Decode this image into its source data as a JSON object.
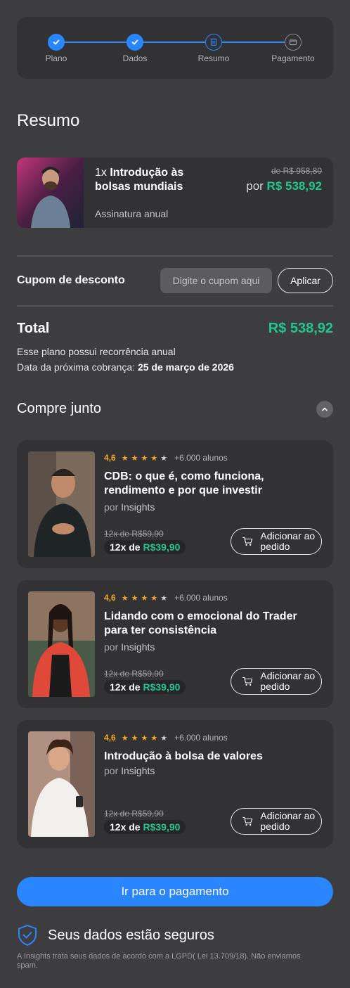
{
  "steps": [
    {
      "label": "Plano",
      "state": "done"
    },
    {
      "label": "Dados",
      "state": "done"
    },
    {
      "label": "Resumo",
      "state": "current"
    },
    {
      "label": "Pagamento",
      "state": "todo"
    }
  ],
  "summary": {
    "title": "Resumo",
    "product": {
      "qty": "1x",
      "name": "Introdução às bolsas mundiais",
      "old_price": "de R$ 958,80",
      "price_prefix": "por",
      "price": "R$ 538,92",
      "plan": "Assinatura anual"
    }
  },
  "coupon": {
    "label": "Cupom de desconto",
    "placeholder": "Digite o cupom aqui",
    "apply": "Aplicar"
  },
  "total": {
    "label": "Total",
    "value": "R$ 538,92",
    "recurrence": "Esse plano possui recorrência anual",
    "next_charge_label": "Data da próxima cobrança:",
    "next_charge_date": "25 de março de 2026"
  },
  "buy_together": {
    "title": "Compre junto",
    "courses": [
      {
        "rating": "4,6",
        "stars": 4,
        "students": "+6.000 alunos",
        "title": "CDB: o que é, como funciona, rendimento e por que investir",
        "by_prefix": "por",
        "by": "Insights",
        "old_price": "12x de R$59,90",
        "price_prefix": "12x de",
        "price": "R$39,90",
        "add_label": "Adicionar ao pedido"
      },
      {
        "rating": "4,6",
        "stars": 4,
        "students": "+6.000 alunos",
        "title": "Lidando com o emocional do Trader para ter consistência",
        "by_prefix": "por",
        "by": "Insights",
        "old_price": "12x de R$59,90",
        "price_prefix": "12x de",
        "price": "R$39,90",
        "add_label": "Adicionar ao pedido"
      },
      {
        "rating": "4,6",
        "stars": 4,
        "students": "+6.000 alunos",
        "title": "Introdução à bolsa de valores",
        "by_prefix": "por",
        "by": "Insights",
        "old_price": "12x de R$59,90",
        "price_prefix": "12x de",
        "price": "R$39,90",
        "add_label": "Adicionar ao pedido"
      }
    ]
  },
  "cta": "Ir para o pagamento",
  "secure": {
    "text": "Seus dados estão seguros",
    "legal": "A Insights trata seus dados de acordo com a LGPD( Lei 13.709/18). Não enviamos spam."
  },
  "colors": {
    "accent": "#2a86ff",
    "price_green": "#22c58b",
    "star": "#f5a623"
  }
}
